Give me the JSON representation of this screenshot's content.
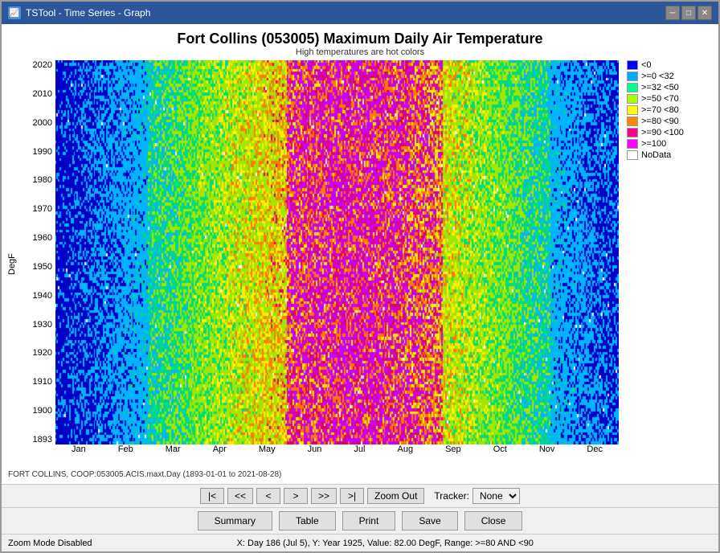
{
  "window": {
    "title": "TSTool - Time Series - Graph"
  },
  "chart": {
    "title": "Fort Collins (053005) Maximum Daily Air Temperature",
    "subtitle": "High temperatures are hot colors",
    "y_axis_label": "DegF",
    "y_ticks": [
      "2020",
      "2010",
      "2000",
      "1990",
      "1980",
      "1970",
      "1960",
      "1950",
      "1940",
      "1930",
      "1920",
      "1910",
      "1900",
      "1893"
    ],
    "x_ticks": [
      "Jan",
      "Feb",
      "Mar",
      "Apr",
      "May",
      "Jun",
      "Jul",
      "Aug",
      "Sep",
      "Oct",
      "Nov",
      "Dec"
    ],
    "data_label": "FORT COLLINS, COOP:053005.ACIS.maxt.Day (1893-01-01 to 2021-08-28)"
  },
  "legend": {
    "items": [
      {
        "label": "<0",
        "color": "#0000ff"
      },
      {
        "label": ">=0 <32",
        "color": "#00aaff"
      },
      {
        "label": ">=32 <50",
        "color": "#00ff88"
      },
      {
        "label": ">=50 <70",
        "color": "#aaff00"
      },
      {
        "label": ">=70 <80",
        "color": "#ffff00"
      },
      {
        "label": ">=80 <90",
        "color": "#ff8800"
      },
      {
        "label": ">=90 <100",
        "color": "#ff0088"
      },
      {
        "label": ">=100",
        "color": "#ff00ff"
      },
      {
        "label": "NoData",
        "color": "#ffffff"
      }
    ]
  },
  "nav": {
    "first_label": "|<",
    "prev_many_label": "<<",
    "prev_label": "<",
    "next_label": ">",
    "next_many_label": ">>",
    "last_label": ">|",
    "zoom_out_label": "Zoom Out",
    "tracker_label": "Tracker:",
    "tracker_option": "None"
  },
  "actions": {
    "summary_label": "Summary",
    "table_label": "Table",
    "print_label": "Print",
    "save_label": "Save",
    "close_label": "Close"
  },
  "status": {
    "zoom_mode": "Zoom Mode Disabled",
    "coords": "X: Day 186 (Jul 5),  Y: Year 1925, Value: 82.00 DegF, Range: >=80 AND <90"
  }
}
